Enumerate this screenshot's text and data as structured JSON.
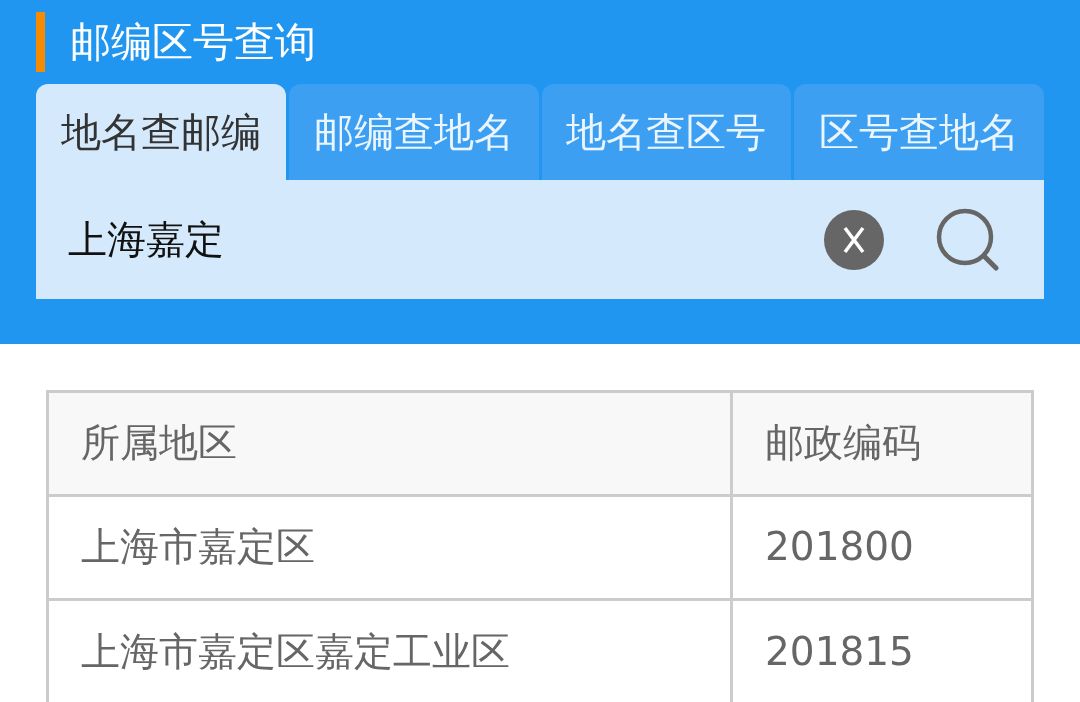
{
  "header": {
    "title": "邮编区号查询"
  },
  "tabs": [
    {
      "label": "地名查邮编",
      "selected": true
    },
    {
      "label": "邮编查地名",
      "selected": false
    },
    {
      "label": "地名查区号",
      "selected": false
    },
    {
      "label": "区号查地名",
      "selected": false
    }
  ],
  "search": {
    "value": "上海嘉定"
  },
  "table": {
    "columns": [
      "所属地区",
      "邮政编码"
    ],
    "rows": [
      [
        "上海市嘉定区",
        "201800"
      ],
      [
        "上海市嘉定区嘉定工业区",
        "201815"
      ]
    ]
  }
}
